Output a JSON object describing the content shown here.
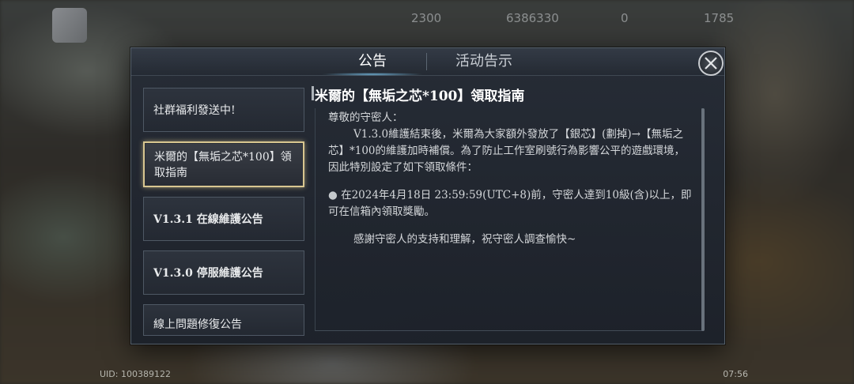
{
  "status_bar": {
    "stat1": "2300",
    "stat2": "6386330",
    "stat3": "0",
    "stat4": "1785",
    "uid": "UID: 100389122",
    "clock": "07:56"
  },
  "tabs": [
    {
      "label": "公告",
      "active": true
    },
    {
      "label": "活动告示",
      "active": false
    }
  ],
  "close_icon": "close-x-icon",
  "announcements": [
    {
      "label": "社群福利發送中!",
      "selected": false
    },
    {
      "label": "米爾的【無垢之芯*100】領取指南",
      "selected": true
    },
    {
      "label": "V1.3.1 在線維護公告",
      "selected": false
    },
    {
      "label": "V1.3.0 停服維護公告",
      "selected": false
    },
    {
      "label": "線上問題修復公告",
      "selected": false
    }
  ],
  "article": {
    "title": "米爾的【無垢之芯*100】領取指南",
    "greeting": "尊敬的守密人：",
    "para1": "V1.3.0維護結束後，米爾為大家額外發放了【銀芯】(劃掉)→【無垢之芯】*100的維護加時補償。為了防止工作室刷號行為影響公平的遊戲環境，因此特別設定了如下領取條件：",
    "bullet": "在2024年4月18日 23:59:59(UTC+8)前，守密人達到10級(含)以上，即可在信箱內領取獎勵。",
    "thanks": "感謝守密人的支持和理解，祝守密人調查愉快~"
  },
  "colors": {
    "selected_border": "#d8c690",
    "modal_bg": "#262c36",
    "tab_glow": "#78bee6"
  }
}
